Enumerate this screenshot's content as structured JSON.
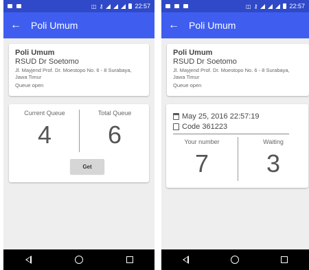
{
  "status_left": {
    "time": "22:57"
  },
  "status_right": {
    "time": "22:57"
  },
  "appbar": {
    "back_glyph": "←",
    "title": "Poli Umum"
  },
  "info": {
    "poli": "Poli Umum",
    "hospital": "RSUD Dr Soetomo",
    "address": "Jl. Mayjend Prof. Dr. Moestopo No. 6 - 8 Surabaya, Jawa Timur",
    "status": "Queue open"
  },
  "queue": {
    "current_label": "Current Queue",
    "current_value": "4",
    "total_label": "Total Queue",
    "total_value": "6",
    "get_label": "Get"
  },
  "ticket": {
    "date": "May 25, 2016 22:57:19",
    "code": "Code 361223",
    "your_number_label": "Your number",
    "your_number_value": "7",
    "waiting_label": "Waiting",
    "waiting_value": "3"
  },
  "icons": {
    "calendar": "calendar-icon",
    "bookmark": "bookmark-icon"
  },
  "colors": {
    "status_bar": "#2f49c8",
    "app_bar": "#3f5ef0",
    "background": "#eeeeee"
  }
}
